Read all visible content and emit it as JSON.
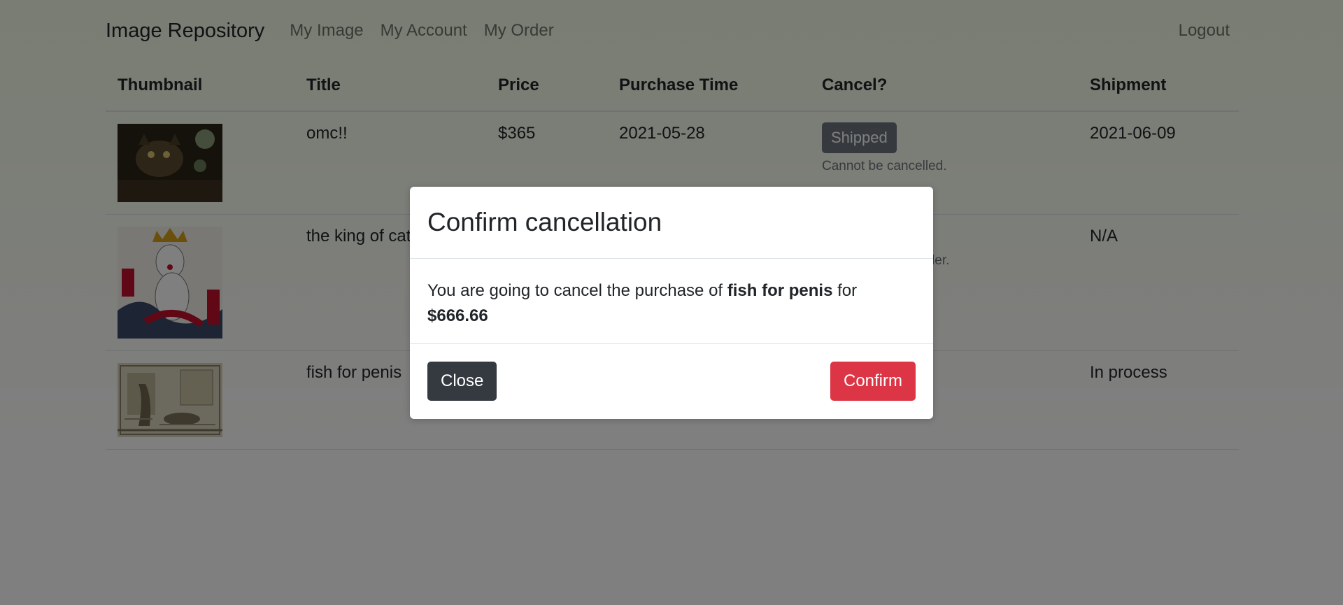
{
  "navbar": {
    "brand": "Image Repository",
    "links": [
      "My Image",
      "My Account",
      "My Order"
    ],
    "logout": "Logout"
  },
  "table": {
    "headers": [
      "Thumbnail",
      "Title",
      "Price",
      "Purchase Time",
      "Cancel?",
      "Shipment"
    ],
    "rows": [
      {
        "thumbnail": "cat-painting",
        "title": "omc!!",
        "price": "$365",
        "purchase_time": "2021-05-28",
        "cancel_button": "Shipped",
        "cancel_note": "Cannot be cancelled.",
        "shipment": "2021-06-09"
      },
      {
        "thumbnail": "crowned-cat",
        "title": "the king of cat",
        "price": "",
        "purchase_time": "",
        "cancel_button": "",
        "cancel_note": "e order.",
        "shipment": "N/A"
      },
      {
        "thumbnail": "fish-engraving",
        "title": "fish for penis",
        "price": "",
        "purchase_time": "",
        "cancel_button": "",
        "cancel_note": "",
        "shipment": "In process"
      }
    ]
  },
  "modal": {
    "title": "Confirm cancellation",
    "body_prefix": "You are going to cancel the purchase of ",
    "item_name": "fish for penis",
    "body_middle": " for",
    "amount": "$666.66",
    "close_label": "Close",
    "confirm_label": "Confirm"
  },
  "colors": {
    "danger": "#dc3545",
    "dark": "#343a40",
    "secondary": "#6c757d"
  }
}
